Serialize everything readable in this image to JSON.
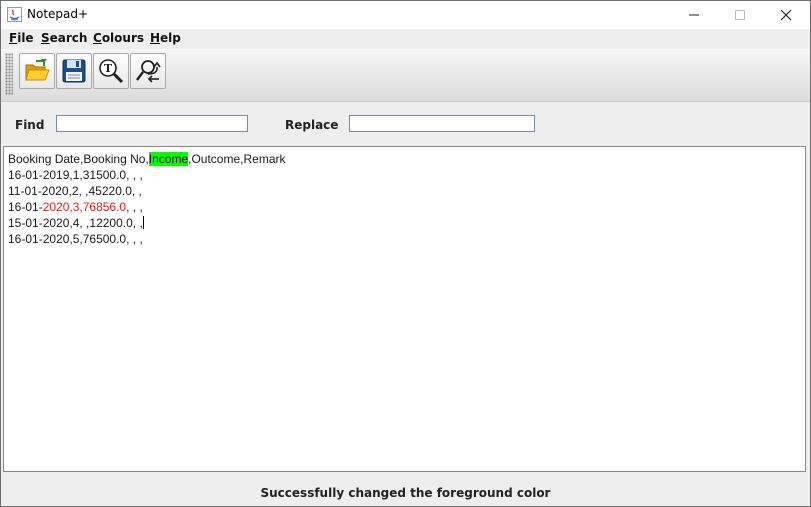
{
  "window": {
    "title": "Notepad+"
  },
  "menu": [
    {
      "label": "File",
      "mnemonic": "F",
      "rest": "ile"
    },
    {
      "label": "Search",
      "mnemonic": "S",
      "rest": "earch"
    },
    {
      "label": "Colours",
      "mnemonic": "C",
      "rest": "olours"
    },
    {
      "label": "Help",
      "mnemonic": "H",
      "rest": "elp"
    }
  ],
  "toolbar": {
    "buttons": [
      {
        "icon": "open-folder-icon"
      },
      {
        "icon": "save-floppy-icon"
      },
      {
        "icon": "find-magnifier-icon"
      },
      {
        "icon": "replace-icon"
      }
    ]
  },
  "find": {
    "label": "Find",
    "value": ""
  },
  "replace": {
    "label": "Replace",
    "value": ""
  },
  "editor": {
    "line1": {
      "a": "Booking Date,Booking No,",
      "highlight": "Income",
      "b": ",Outcome,Remark"
    },
    "line2": "16-01-2019,1,31500.0, , ,",
    "line3": "11-01-2020,2, ,45220.0, ,",
    "line4": {
      "a": "16-01-",
      "red": "2020,3,76856.0",
      "b": ", , ,"
    },
    "line5": "15-01-2020,4, ,12200.0, ,",
    "line6": "16-01-2020,5,76500.0, , ,"
  },
  "colors": {
    "highlight": "#00ff00",
    "foreground_red": "#e02020"
  },
  "status": {
    "text": "Successfully changed the foreground color"
  }
}
